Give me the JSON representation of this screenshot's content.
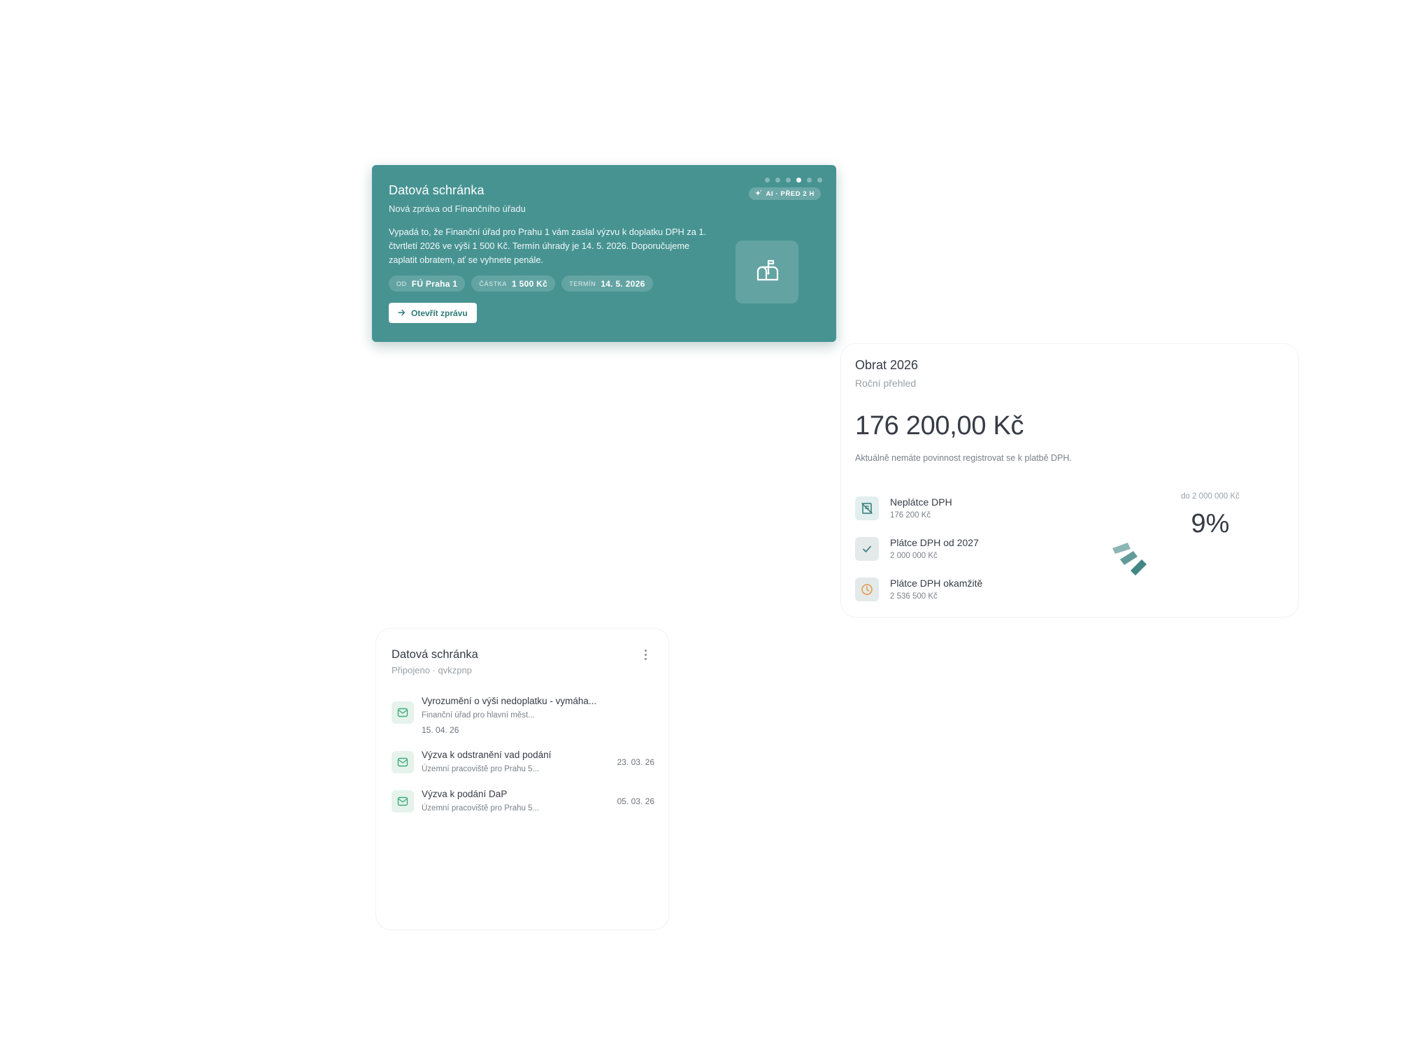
{
  "colors": {
    "banner_bg": "#469392",
    "accent": "#2e7a78",
    "green_icon": "#3fab7a",
    "orange_icon": "#e59a45"
  },
  "banner": {
    "title": "Datová schránka",
    "subtitle": "Nová zpráva od Finančního úřadu",
    "body": "Vypadá to, že Finanční úřad pro Prahu 1 vám zaslal výzvu k doplatku DPH za 1. čtvrtletí 2026 ve výši 1 500 Kč. Termín úhrady je 14. 5. 2026. Doporučujeme zaplatit obratem, ať se vyhnete penále.",
    "chips": [
      {
        "key": "OD",
        "value": "FÚ Praha 1"
      },
      {
        "key": "ČÁSTKA",
        "value": "1 500 Kč"
      },
      {
        "key": "TERMÍN",
        "value": "14. 5. 2026"
      }
    ],
    "button_label": "Otevřít zprávu",
    "badge": "AI · PŘED 2 H",
    "pager_count": 6,
    "pager_active_index": 3,
    "icon": "mailbox-icon"
  },
  "turnover": {
    "title": "Obrat 2026",
    "subtitle": "Roční přehled",
    "amount": "176 200,00 Kč",
    "note": "Aktuálně nemáte povinnost registrovat se k platbě DPH.",
    "tiers": [
      {
        "name": "Neplátce DPH",
        "value": "176 200 Kč",
        "icon": "no-receipt-icon"
      },
      {
        "name": "Plátce DPH od 2027",
        "value": "2 000 000 Kč",
        "icon": "check-icon"
      },
      {
        "name": "Plátce DPH okamžitě",
        "value": "2 536 500 Kč",
        "icon": "clock-icon"
      }
    ],
    "gauge": {
      "label": "do 2 000 000 Kč",
      "percent_text": "9%",
      "percent": 9
    }
  },
  "mailbox_list": {
    "title": "Datová schránka",
    "subtitle": "Připojeno · qvkzpnp",
    "items": [
      {
        "title": "Vyrozumění o výši nedoplatku - vymáha...",
        "from": "Finanční úřad pro hlavní měst...",
        "date": "15. 04. 26"
      },
      {
        "title": "Výzva k odstranění vad podání",
        "from": "Územní pracoviště pro Prahu 5...",
        "date": "23. 03. 26"
      },
      {
        "title": "Výzva k podání DaP",
        "from": "Územní pracoviště pro Prahu 5...",
        "date": "05. 03. 26"
      }
    ]
  }
}
